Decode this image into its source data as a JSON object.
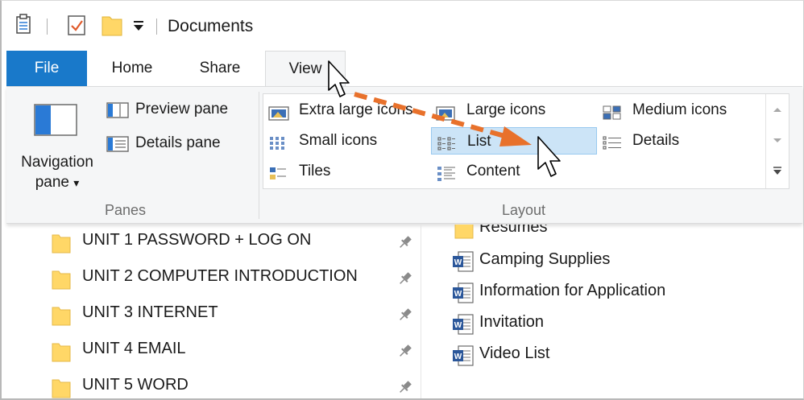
{
  "window": {
    "title": "Documents"
  },
  "tabs": [
    {
      "label": "File"
    },
    {
      "label": "Home"
    },
    {
      "label": "Share"
    },
    {
      "label": "View"
    }
  ],
  "ribbon": {
    "panes": {
      "group_label": "Panes",
      "navigation_pane_label": "Navigation pane",
      "navigation_pane_arrow": "▾",
      "preview_pane_label": "Preview pane",
      "details_pane_label": "Details pane"
    },
    "layout": {
      "group_label": "Layout",
      "options": [
        {
          "label": "Extra large icons",
          "icon": "extra-large-icons-icon"
        },
        {
          "label": "Large icons",
          "icon": "large-icons-icon"
        },
        {
          "label": "Medium icons",
          "icon": "medium-icons-icon"
        },
        {
          "label": "Small icons",
          "icon": "small-icons-icon"
        },
        {
          "label": "List",
          "icon": "list-icon",
          "selected": true
        },
        {
          "label": "Details",
          "icon": "details-icon"
        },
        {
          "label": "Tiles",
          "icon": "tiles-icon"
        },
        {
          "label": "Content",
          "icon": "content-icon"
        }
      ]
    }
  },
  "nav_items": [
    {
      "label": "UNIT 1 PASSWORD + LOG ON"
    },
    {
      "label": "UNIT 2 COMPUTER INTRODUCTION"
    },
    {
      "label": "UNIT 3 INTERNET"
    },
    {
      "label": "UNIT 4 EMAIL"
    },
    {
      "label": "UNIT 5  WORD"
    }
  ],
  "files": [
    {
      "label": "Resumes",
      "type": "folder"
    },
    {
      "label": "Camping Supplies",
      "type": "word-document"
    },
    {
      "label": "Information for Application",
      "type": "word-document"
    },
    {
      "label": "Invitation",
      "type": "word-document"
    },
    {
      "label": "Video List",
      "type": "word-document"
    }
  ],
  "colors": {
    "file_tab": "#1979ca",
    "selection": "#cce4f7",
    "selection_border": "#99c9ef",
    "arrow": "#e8712b",
    "folder": "#ffd767"
  }
}
